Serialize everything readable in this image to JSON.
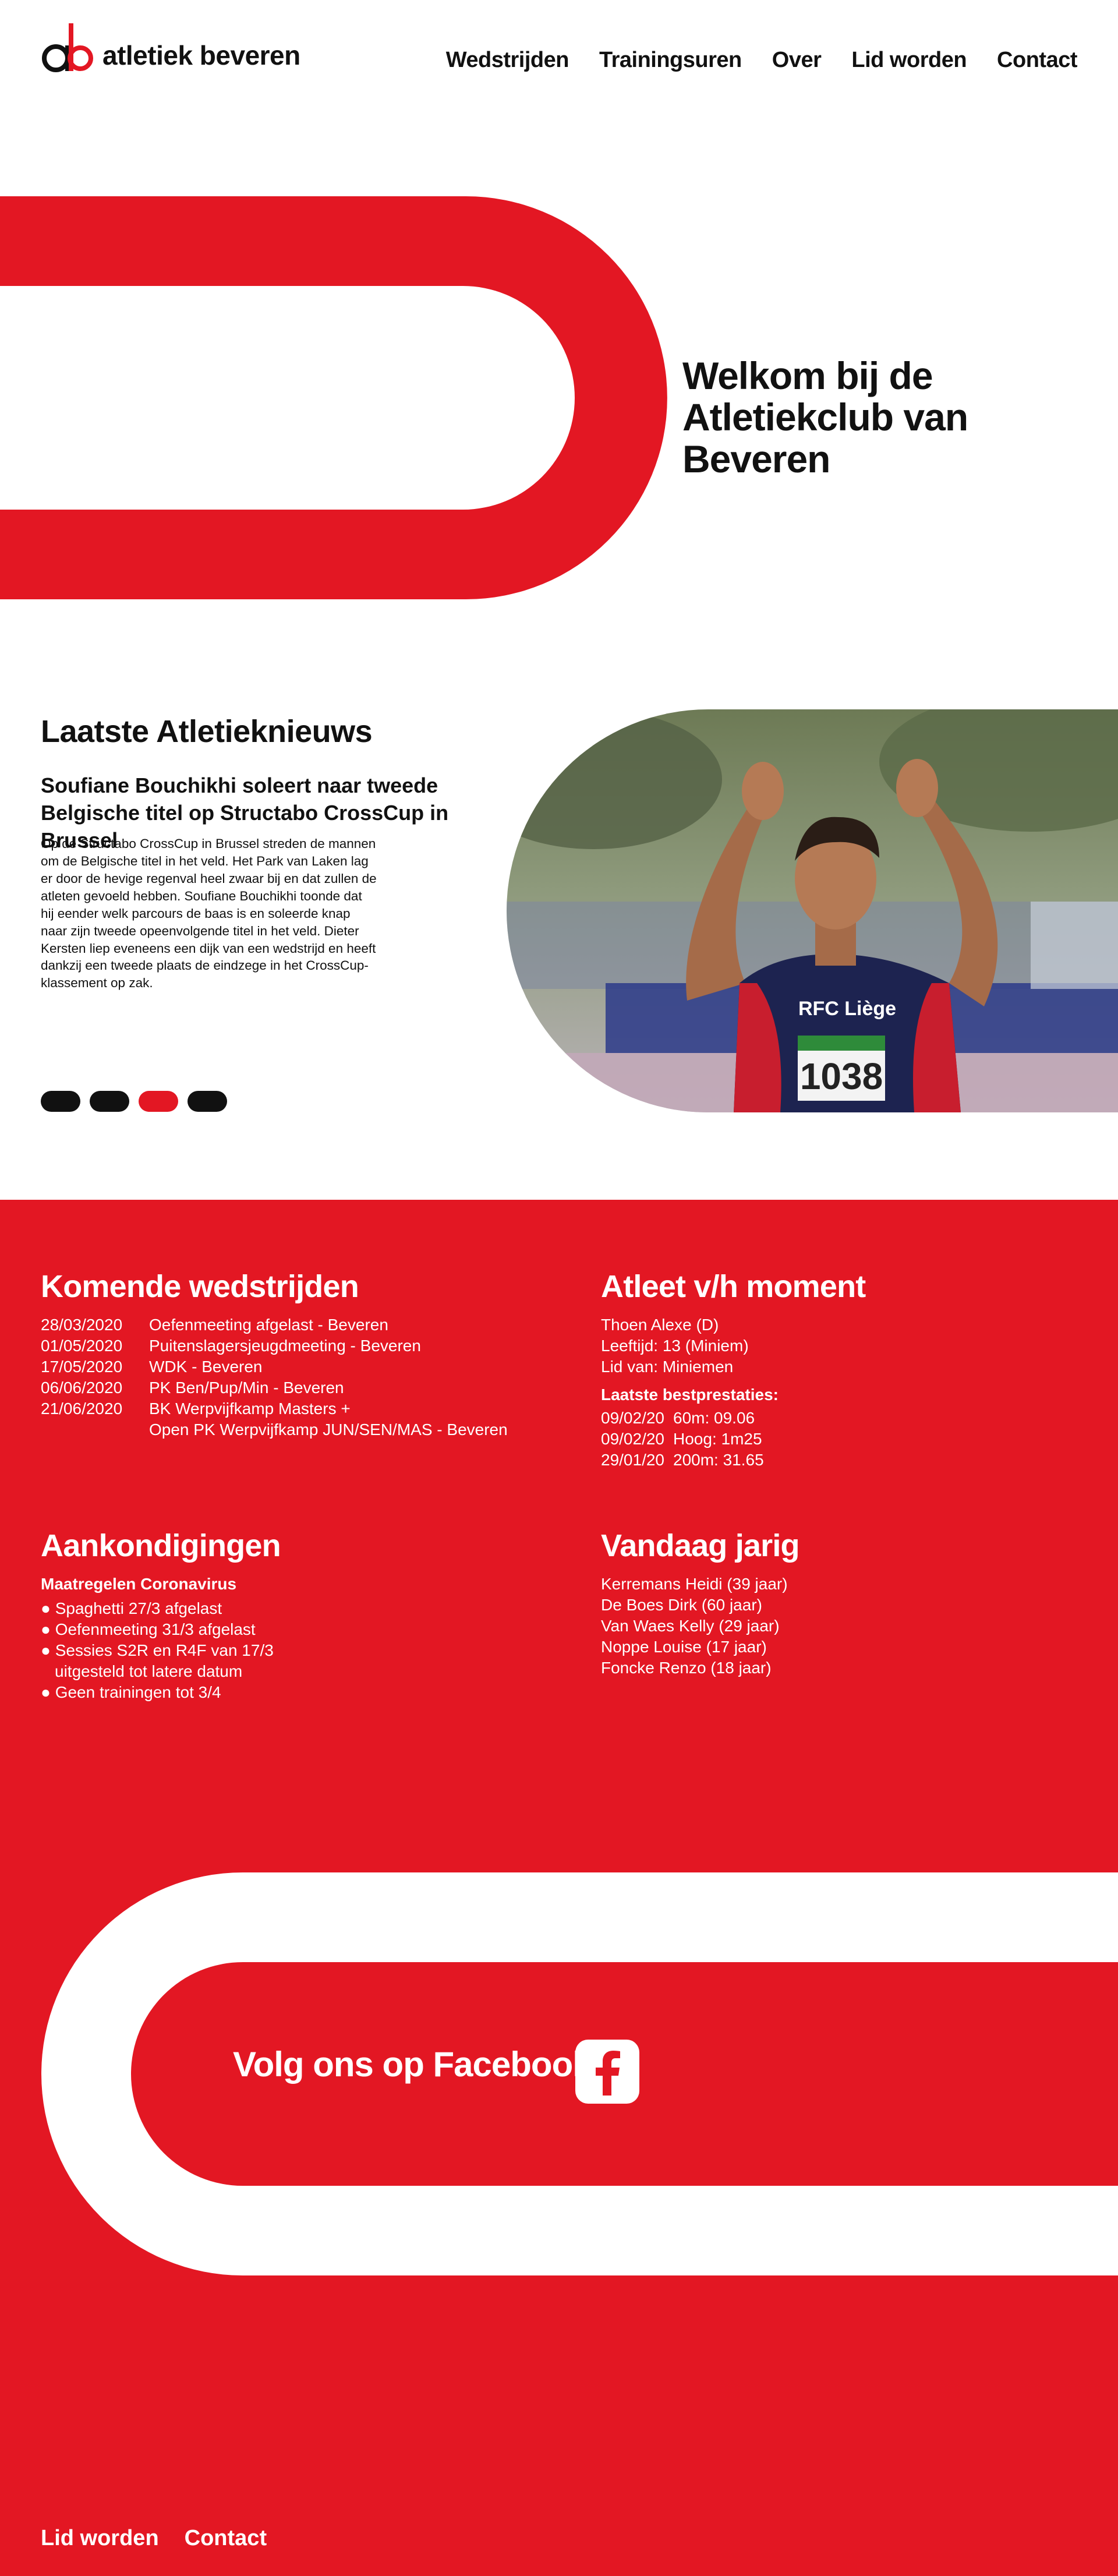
{
  "brand": {
    "name": "atletiek beveren",
    "primary": "#e31723",
    "dark": "#111111"
  },
  "nav": [
    {
      "label": "Wedstrijden"
    },
    {
      "label": "Trainingsuren"
    },
    {
      "label": "Over"
    },
    {
      "label": "Lid worden"
    },
    {
      "label": "Contact"
    }
  ],
  "hero": {
    "title": "Welkom bij de Atletiekclub van Beveren"
  },
  "news": {
    "title": "Laatste Atletieknieuws",
    "headline": "Soufiane Bouchikhi soleert naar tweede Belgische titel op Structabo CrossCup in Brussel",
    "body": "Op de Structabo CrossCup in Brussel streden de mannen om de Belgische titel in het veld. Het Park van Laken lag er door de hevige regenval heel zwaar bij en dat zullen de atleten gevoeld hebben. Soufiane Bouchikhi toonde dat hij eender welk parcours de baas is en soleerde knap naar zijn tweede opeenvolgende titel in het veld. Dieter Kersten liep eveneens een dijk van een wedstrijd en heeft dankzij een tweede plaats de eindzege in het CrossCup-klassement op zak.",
    "active_slide": 3,
    "slide_count": 4,
    "photo": {
      "bib": "1038",
      "club": "RFC Liège"
    }
  },
  "competitions": {
    "title": "Komende wedstrijden",
    "items": [
      {
        "date": "28/03/2020",
        "name": "Oefenmeeting afgelast -   Beveren"
      },
      {
        "date": "01/05/2020",
        "name": "Puitenslagersjeugdmeeting - Beveren"
      },
      {
        "date": "17/05/2020",
        "name": "WDK - Beveren"
      },
      {
        "date": "06/06/2020",
        "name": "PK Ben/Pup/Min - Beveren"
      },
      {
        "date": "21/06/2020",
        "name": "BK Werpvijfkamp Masters +"
      },
      {
        "date": "",
        "name": "Open PK Werpvijfkamp JUN/SEN/MAS - Beveren"
      }
    ]
  },
  "athlete": {
    "title": "Atleet v/h moment",
    "name": "Thoen Alexe (D)",
    "age": "Leeftijd: 13 (Miniem)",
    "member": "Lid van: Miniemen",
    "records_title": "Laatste bestprestaties:",
    "records": [
      {
        "date": "09/02/20",
        "result": "60m: 09.06"
      },
      {
        "date": "09/02/20",
        "result": "Hoog: 1m25"
      },
      {
        "date": "29/01/20",
        "result": "200m: 31.65"
      }
    ]
  },
  "announcements": {
    "title": "Aankondigingen",
    "subtitle": "Maatregelen Coronavirus",
    "items": [
      "Spaghetti 27/3 afgelast",
      "Oefenmeeting 31/3 afgelast",
      "Sessies S2R en R4F van 17/3",
      "Geen trainingen tot 3/4"
    ],
    "continuation": "uitgesteld tot latere datum"
  },
  "birthdays": {
    "title": "Vandaag jarig",
    "items": [
      "Kerremans Heidi (39 jaar)",
      "De Boes Dirk (60 jaar)",
      "Van Waes Kelly (29 jaar)",
      "Noppe Louise (17 jaar)",
      "Foncke Renzo (18 jaar)"
    ]
  },
  "facebook": {
    "label": "Volg ons op Facebook",
    "icon": "facebook-icon"
  },
  "footer": [
    {
      "label": "Lid worden"
    },
    {
      "label": "Contact"
    }
  ]
}
